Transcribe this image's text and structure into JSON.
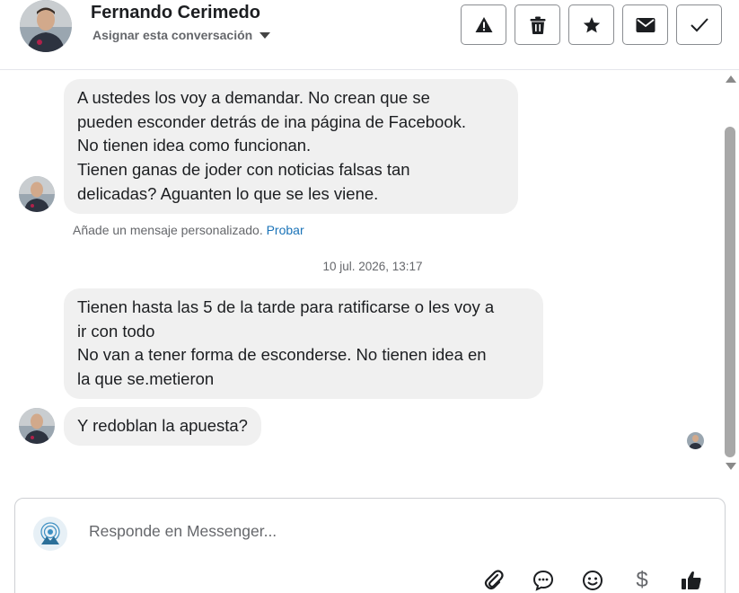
{
  "header": {
    "contact_name": "Fernando Cerimedo",
    "assign_label": "Asignar esta conversación",
    "actions": [
      {
        "name": "report-button",
        "icon": "warning-icon"
      },
      {
        "name": "delete-button",
        "icon": "trash-icon"
      },
      {
        "name": "star-button",
        "icon": "star-icon"
      },
      {
        "name": "mark-unread-button",
        "icon": "envelope-icon"
      },
      {
        "name": "mark-done-button",
        "icon": "check-icon"
      }
    ]
  },
  "messages": [
    {
      "text": "A ustedes los voy a demandar.  No crean que se\npueden esconder detrás de ina página de Facebook.\nNo tienen idea como funcionan.\nTienen ganas de joder con noticias falsas tan\ndelicadas?   Aguanten lo que se les viene."
    },
    {
      "text": "Tienen hasta las 5 de la tarde para ratificarse o les voy a\nir con todo\nNo van a tener forma de esconderse.  No tienen idea en\nla que se.metieron"
    },
    {
      "text": "Y redoblan la apuesta?"
    }
  ],
  "hint": {
    "text": "Añade un mensaje personalizado.",
    "link": "Probar"
  },
  "timestamp": "10 jul. 2026, 13:17",
  "composer": {
    "placeholder": "Responde en Messenger...",
    "actions": [
      "attach-icon",
      "saved-reply-icon",
      "emoji-icon",
      "dollar-icon",
      "thumbs-up-icon"
    ]
  },
  "colors": {
    "bubble": "#f0f0f0",
    "link": "#1a73b8",
    "muted": "#65676b"
  }
}
